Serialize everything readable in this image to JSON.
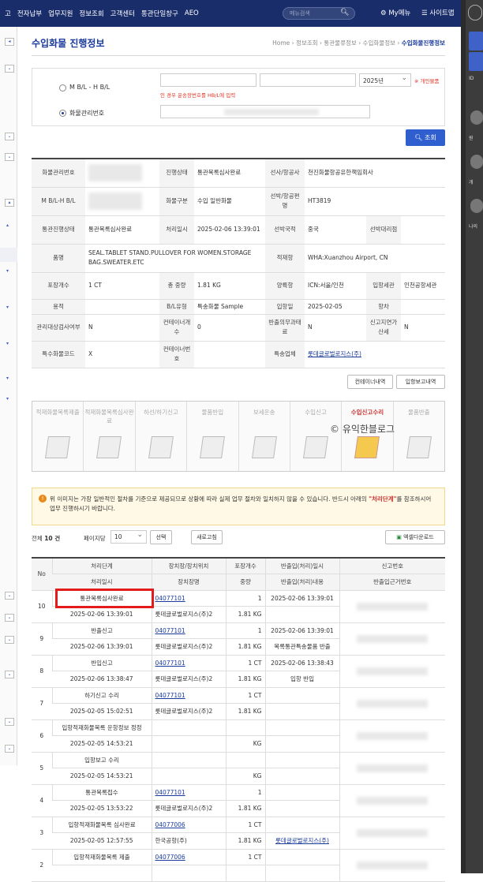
{
  "nav": {
    "items": [
      "고",
      "전자납부",
      "업무지원",
      "정보조회",
      "고객센터",
      "통관단일창구",
      "AEO"
    ],
    "search_placeholder": "메뉴검색",
    "my_menu": "My메뉴",
    "sitemap": "사이트맵"
  },
  "right_panel": {
    "id_label": "ID",
    "labels": [
      "원",
      "개",
      "나의"
    ]
  },
  "page": {
    "title": "수입화물 진행정보",
    "breadcrumb": [
      "Home",
      "정보조회",
      "통관물류정보",
      "수입화물정보"
    ],
    "breadcrumb_current": "수입화물진행정보"
  },
  "search": {
    "option_mbl": "M B/L - H B/L",
    "option_cargo": "화물관리번호",
    "year": "2025년",
    "personal_cargo": "※ 개인물품",
    "note": "인 경우 운송장번호를 HB/L에 입력",
    "search_button": "조회"
  },
  "detail": {
    "rows": [
      [
        "화물관리번호",
        "",
        "진행상태",
        "통관목록심사완료",
        "선사/항공사",
        "천진화물항공유한책임회사"
      ],
      [
        "M B/L-H B/L",
        "",
        "화물구분",
        "수입 일반화물",
        "선박/항공편명",
        "HT3819"
      ],
      [
        "통관진행상태",
        "통관목록심사완료",
        "처리일시",
        "2025-02-06 13:39:01",
        "선박국적",
        "중국",
        "선박대리점",
        ""
      ],
      [
        "품명",
        "SEAL.TABLET STAND.PULLOVER FOR WOMEN.STORAGE BAG.SWEATER.ETC",
        "적재항",
        "WHA:Xuanzhou Airport, CN"
      ],
      [
        "포장개수",
        "1 CT",
        "총 중량",
        "1.81 KG",
        "양륙항",
        "ICN:서울/인천",
        "입항세관",
        "인천공항세관"
      ],
      [
        "용적",
        "",
        "B/L유형",
        "특송화물 Sample",
        "입항일",
        "2025-02-05",
        "항차",
        ""
      ],
      [
        "관리대상검사여부",
        "N",
        "컨테이너개수",
        "0",
        "반출의무과태료",
        "N",
        "신고지연가산세",
        "N"
      ],
      [
        "특수화물코드",
        "X",
        "컨테이너번호",
        "",
        "특송업체",
        "롯데글로벌로지스(주)"
      ]
    ],
    "btn_container": "컨테이너내역",
    "btn_report": "입항보고내역"
  },
  "steps": [
    {
      "label": "적재화물목록제출"
    },
    {
      "label": "적재화물목록심사완료"
    },
    {
      "label": "하선/하기신고"
    },
    {
      "label": "물품반입"
    },
    {
      "label": "보세운송"
    },
    {
      "label": "수입신고"
    },
    {
      "label": "수입신고수리"
    },
    {
      "label": "물품반출"
    }
  ],
  "watermark": "© 유익한블로그",
  "notice": {
    "text1": "위 이미지는 가장 일반적인 절차를 기준으로 제공되므로 상황에 따라 실제 업무 절차와 일치하지 않을 수 있습니다. 반드시 아래의 ",
    "highlight": "\"처리단계\"",
    "text2": "를 참조하시어 업무 진행하시기 바랍니다."
  },
  "list": {
    "total_label": "전체",
    "total_count": "10 건",
    "per_page_label": "페이지당",
    "per_page": "10",
    "select_button": "선택",
    "refresh_button": "새로고침",
    "excel_button": "엑셀다운로드",
    "headers": {
      "no": "No",
      "step": "처리단계",
      "datetime": "처리일시",
      "loc": "장치장/장치위치",
      "locname": "장치장명",
      "pkg": "포장개수",
      "weight": "중량",
      "inout": "반출입(처리)일시",
      "inout_content": "반출입(처리)내용",
      "report_no": "신고번호",
      "basis_no": "반출입근거번호"
    },
    "rows": [
      {
        "no": "10",
        "step": "통관목록심사완료",
        "date": "2025-02-06 13:39:01",
        "code": "04077101",
        "name": "롯데글로벌로지스(주)2",
        "pkg": "1",
        "wt": "1.81 KG",
        "io": "2025-02-06 13:39:01",
        "ioc": ""
      },
      {
        "no": "9",
        "step": "반출신고",
        "date": "2025-02-06 13:39:01",
        "code": "04077101",
        "name": "롯데글로벌로지스(주)2",
        "pkg": "1",
        "wt": "1.81 KG",
        "io": "2025-02-06 13:39:01",
        "ioc": "목록통관특송물품 반출"
      },
      {
        "no": "8",
        "step": "반입신고",
        "date": "2025-02-06 13:38:47",
        "code": "04077101",
        "name": "롯데글로벌로지스(주)2",
        "pkg": "1 CT",
        "wt": "1.81 KG",
        "io": "2025-02-06 13:38:43",
        "ioc": "입항 반입"
      },
      {
        "no": "7",
        "step": "하기신고 수리",
        "date": "2025-02-05 15:02:51",
        "code": "04077101",
        "name": "롯데글로벌로지스(주)2",
        "pkg": "1 CT",
        "wt": "1.81 KG",
        "io": "",
        "ioc": ""
      },
      {
        "no": "6",
        "step": "입항적재화물목록 운항정보 정정",
        "date": "2025-02-05 14:53:21",
        "code": "",
        "name": "",
        "pkg": "",
        "wt": "KG",
        "io": "",
        "ioc": ""
      },
      {
        "no": "5",
        "step": "입항보고 수리",
        "date": "2025-02-05 14:53:21",
        "code": "",
        "name": "",
        "pkg": "",
        "wt": "KG",
        "io": "",
        "ioc": ""
      },
      {
        "no": "4",
        "step": "통관목록접수",
        "date": "2025-02-05 13:53:22",
        "code": "04077101",
        "name": "롯데글로벌로지스(주)2",
        "pkg": "1",
        "wt": "1.81 KG",
        "io": "",
        "ioc": ""
      },
      {
        "no": "3",
        "step": "입항적재화물목록 심사완료",
        "date": "2025-02-05 12:57:55",
        "code": "04077006",
        "name": "한국공항(주)",
        "pkg": "1 CT",
        "wt": "1.81 KG",
        "io": "",
        "ioc": "롯데글로벌로지스(주)"
      },
      {
        "no": "2",
        "step": "입항적재화물목록 제출",
        "date": "",
        "code": "04077006",
        "name": "",
        "pkg": "1 CT",
        "wt": "",
        "io": "",
        "ioc": ""
      }
    ]
  }
}
